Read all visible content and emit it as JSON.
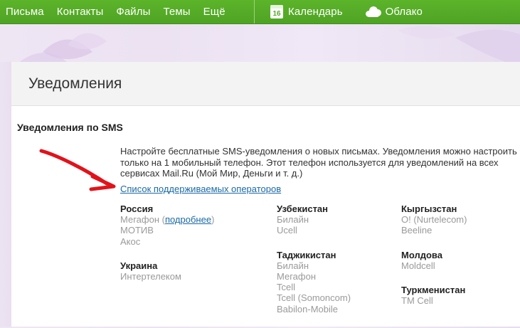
{
  "topbar": {
    "left_items": [
      "Письма",
      "Контакты",
      "Файлы",
      "Темы",
      "Ещё"
    ],
    "calendar_label": "Календарь",
    "calendar_day": "16",
    "cloud_label": "Облако"
  },
  "panel": {
    "title": "Уведомления",
    "section_title": "Уведомления по SMS",
    "description": "Настройте бесплатные SMS-уведомления о новых письмах. Уведомления можно настроить только на 1 мобильный телефон. Этот телефон используется для уведомлений на всех сервисах Mail.Ru (Мой Мир, Деньги и т. д.)",
    "operators_link": "Список поддерживаемых операторов",
    "russia": {
      "country": "Россия",
      "megafon": "Мегафон",
      "open_paren": " (",
      "more_link": "подробнее",
      "close_paren": ")",
      "others": [
        "МОТИВ",
        "Акос"
      ]
    },
    "ukraine": {
      "country": "Украина",
      "operators": [
        "Интертелеком"
      ]
    },
    "uzbekistan": {
      "country": "Узбекистан",
      "operators": [
        "Билайн",
        "Ucell"
      ]
    },
    "tajikistan": {
      "country": "Таджикистан",
      "operators": [
        "Билайн",
        "Мегафон",
        "Tcell",
        "Tcell (Somoncom)",
        "Babilon-Mobile"
      ]
    },
    "kyrgyzstan": {
      "country": "Кыргызстан",
      "operators": [
        "O! (Nurtelecom)",
        "Beeline"
      ]
    },
    "moldova": {
      "country": "Молдова",
      "operators": [
        "Moldcell"
      ]
    },
    "turkmenistan": {
      "country": "Туркменистан",
      "operators": [
        "TM Cell"
      ]
    }
  },
  "colors": {
    "topbar_green": "#53a826",
    "link_blue": "#1a6aa7",
    "annotation_arrow_red": "#e2121a"
  }
}
